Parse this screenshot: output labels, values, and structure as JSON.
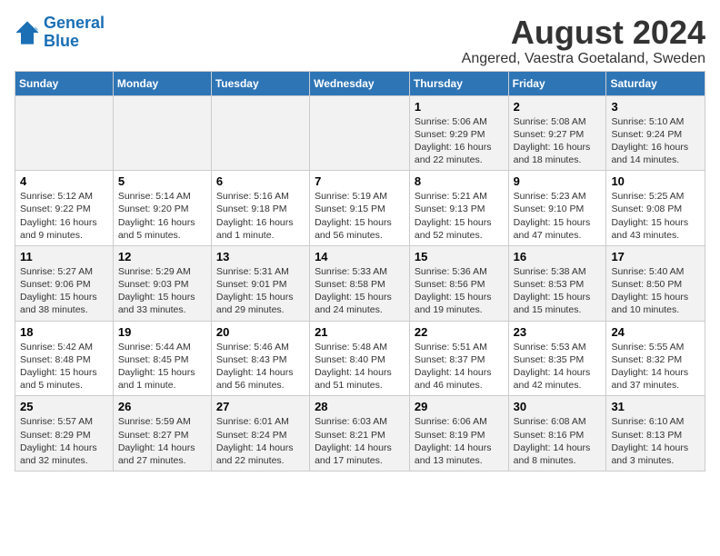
{
  "header": {
    "logo_line1": "General",
    "logo_line2": "Blue",
    "title": "August 2024",
    "subtitle": "Angered, Vaestra Goetaland, Sweden"
  },
  "days_of_week": [
    "Sunday",
    "Monday",
    "Tuesday",
    "Wednesday",
    "Thursday",
    "Friday",
    "Saturday"
  ],
  "weeks": [
    [
      {
        "day": "",
        "info": ""
      },
      {
        "day": "",
        "info": ""
      },
      {
        "day": "",
        "info": ""
      },
      {
        "day": "",
        "info": ""
      },
      {
        "day": "1",
        "info": "Sunrise: 5:06 AM\nSunset: 9:29 PM\nDaylight: 16 hours\nand 22 minutes."
      },
      {
        "day": "2",
        "info": "Sunrise: 5:08 AM\nSunset: 9:27 PM\nDaylight: 16 hours\nand 18 minutes."
      },
      {
        "day": "3",
        "info": "Sunrise: 5:10 AM\nSunset: 9:24 PM\nDaylight: 16 hours\nand 14 minutes."
      }
    ],
    [
      {
        "day": "4",
        "info": "Sunrise: 5:12 AM\nSunset: 9:22 PM\nDaylight: 16 hours\nand 9 minutes."
      },
      {
        "day": "5",
        "info": "Sunrise: 5:14 AM\nSunset: 9:20 PM\nDaylight: 16 hours\nand 5 minutes."
      },
      {
        "day": "6",
        "info": "Sunrise: 5:16 AM\nSunset: 9:18 PM\nDaylight: 16 hours\nand 1 minute."
      },
      {
        "day": "7",
        "info": "Sunrise: 5:19 AM\nSunset: 9:15 PM\nDaylight: 15 hours\nand 56 minutes."
      },
      {
        "day": "8",
        "info": "Sunrise: 5:21 AM\nSunset: 9:13 PM\nDaylight: 15 hours\nand 52 minutes."
      },
      {
        "day": "9",
        "info": "Sunrise: 5:23 AM\nSunset: 9:10 PM\nDaylight: 15 hours\nand 47 minutes."
      },
      {
        "day": "10",
        "info": "Sunrise: 5:25 AM\nSunset: 9:08 PM\nDaylight: 15 hours\nand 43 minutes."
      }
    ],
    [
      {
        "day": "11",
        "info": "Sunrise: 5:27 AM\nSunset: 9:06 PM\nDaylight: 15 hours\nand 38 minutes."
      },
      {
        "day": "12",
        "info": "Sunrise: 5:29 AM\nSunset: 9:03 PM\nDaylight: 15 hours\nand 33 minutes."
      },
      {
        "day": "13",
        "info": "Sunrise: 5:31 AM\nSunset: 9:01 PM\nDaylight: 15 hours\nand 29 minutes."
      },
      {
        "day": "14",
        "info": "Sunrise: 5:33 AM\nSunset: 8:58 PM\nDaylight: 15 hours\nand 24 minutes."
      },
      {
        "day": "15",
        "info": "Sunrise: 5:36 AM\nSunset: 8:56 PM\nDaylight: 15 hours\nand 19 minutes."
      },
      {
        "day": "16",
        "info": "Sunrise: 5:38 AM\nSunset: 8:53 PM\nDaylight: 15 hours\nand 15 minutes."
      },
      {
        "day": "17",
        "info": "Sunrise: 5:40 AM\nSunset: 8:50 PM\nDaylight: 15 hours\nand 10 minutes."
      }
    ],
    [
      {
        "day": "18",
        "info": "Sunrise: 5:42 AM\nSunset: 8:48 PM\nDaylight: 15 hours\nand 5 minutes."
      },
      {
        "day": "19",
        "info": "Sunrise: 5:44 AM\nSunset: 8:45 PM\nDaylight: 15 hours\nand 1 minute."
      },
      {
        "day": "20",
        "info": "Sunrise: 5:46 AM\nSunset: 8:43 PM\nDaylight: 14 hours\nand 56 minutes."
      },
      {
        "day": "21",
        "info": "Sunrise: 5:48 AM\nSunset: 8:40 PM\nDaylight: 14 hours\nand 51 minutes."
      },
      {
        "day": "22",
        "info": "Sunrise: 5:51 AM\nSunset: 8:37 PM\nDaylight: 14 hours\nand 46 minutes."
      },
      {
        "day": "23",
        "info": "Sunrise: 5:53 AM\nSunset: 8:35 PM\nDaylight: 14 hours\nand 42 minutes."
      },
      {
        "day": "24",
        "info": "Sunrise: 5:55 AM\nSunset: 8:32 PM\nDaylight: 14 hours\nand 37 minutes."
      }
    ],
    [
      {
        "day": "25",
        "info": "Sunrise: 5:57 AM\nSunset: 8:29 PM\nDaylight: 14 hours\nand 32 minutes."
      },
      {
        "day": "26",
        "info": "Sunrise: 5:59 AM\nSunset: 8:27 PM\nDaylight: 14 hours\nand 27 minutes."
      },
      {
        "day": "27",
        "info": "Sunrise: 6:01 AM\nSunset: 8:24 PM\nDaylight: 14 hours\nand 22 minutes."
      },
      {
        "day": "28",
        "info": "Sunrise: 6:03 AM\nSunset: 8:21 PM\nDaylight: 14 hours\nand 17 minutes."
      },
      {
        "day": "29",
        "info": "Sunrise: 6:06 AM\nSunset: 8:19 PM\nDaylight: 14 hours\nand 13 minutes."
      },
      {
        "day": "30",
        "info": "Sunrise: 6:08 AM\nSunset: 8:16 PM\nDaylight: 14 hours\nand 8 minutes."
      },
      {
        "day": "31",
        "info": "Sunrise: 6:10 AM\nSunset: 8:13 PM\nDaylight: 14 hours\nand 3 minutes."
      }
    ]
  ]
}
